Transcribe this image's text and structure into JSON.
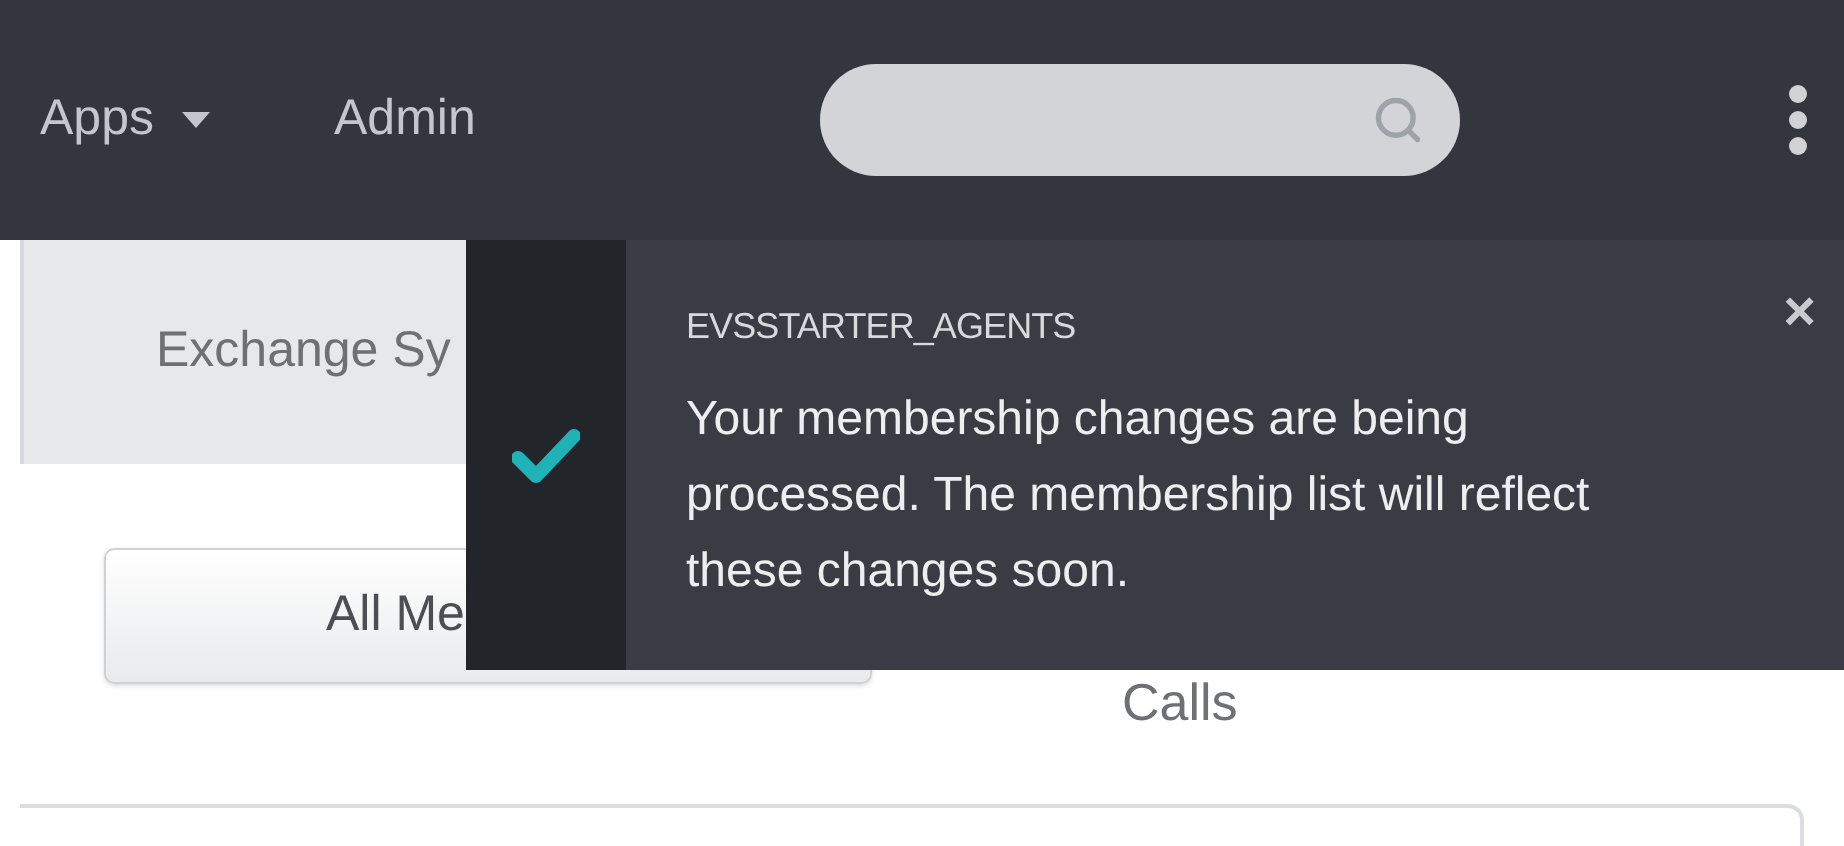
{
  "nav": {
    "items": [
      {
        "label": "Apps",
        "kind": "dropdown"
      },
      {
        "label": "Admin",
        "kind": "link"
      }
    ]
  },
  "tab": {
    "label": "Exchange Sy"
  },
  "filter_button": {
    "label": "All Me"
  },
  "column_label": "Calls",
  "toast": {
    "title": "EVSSTARTER_AGENTS",
    "message": "Your membership changes are being processed. The membership list will reflect these changes soon.",
    "close": "×"
  }
}
